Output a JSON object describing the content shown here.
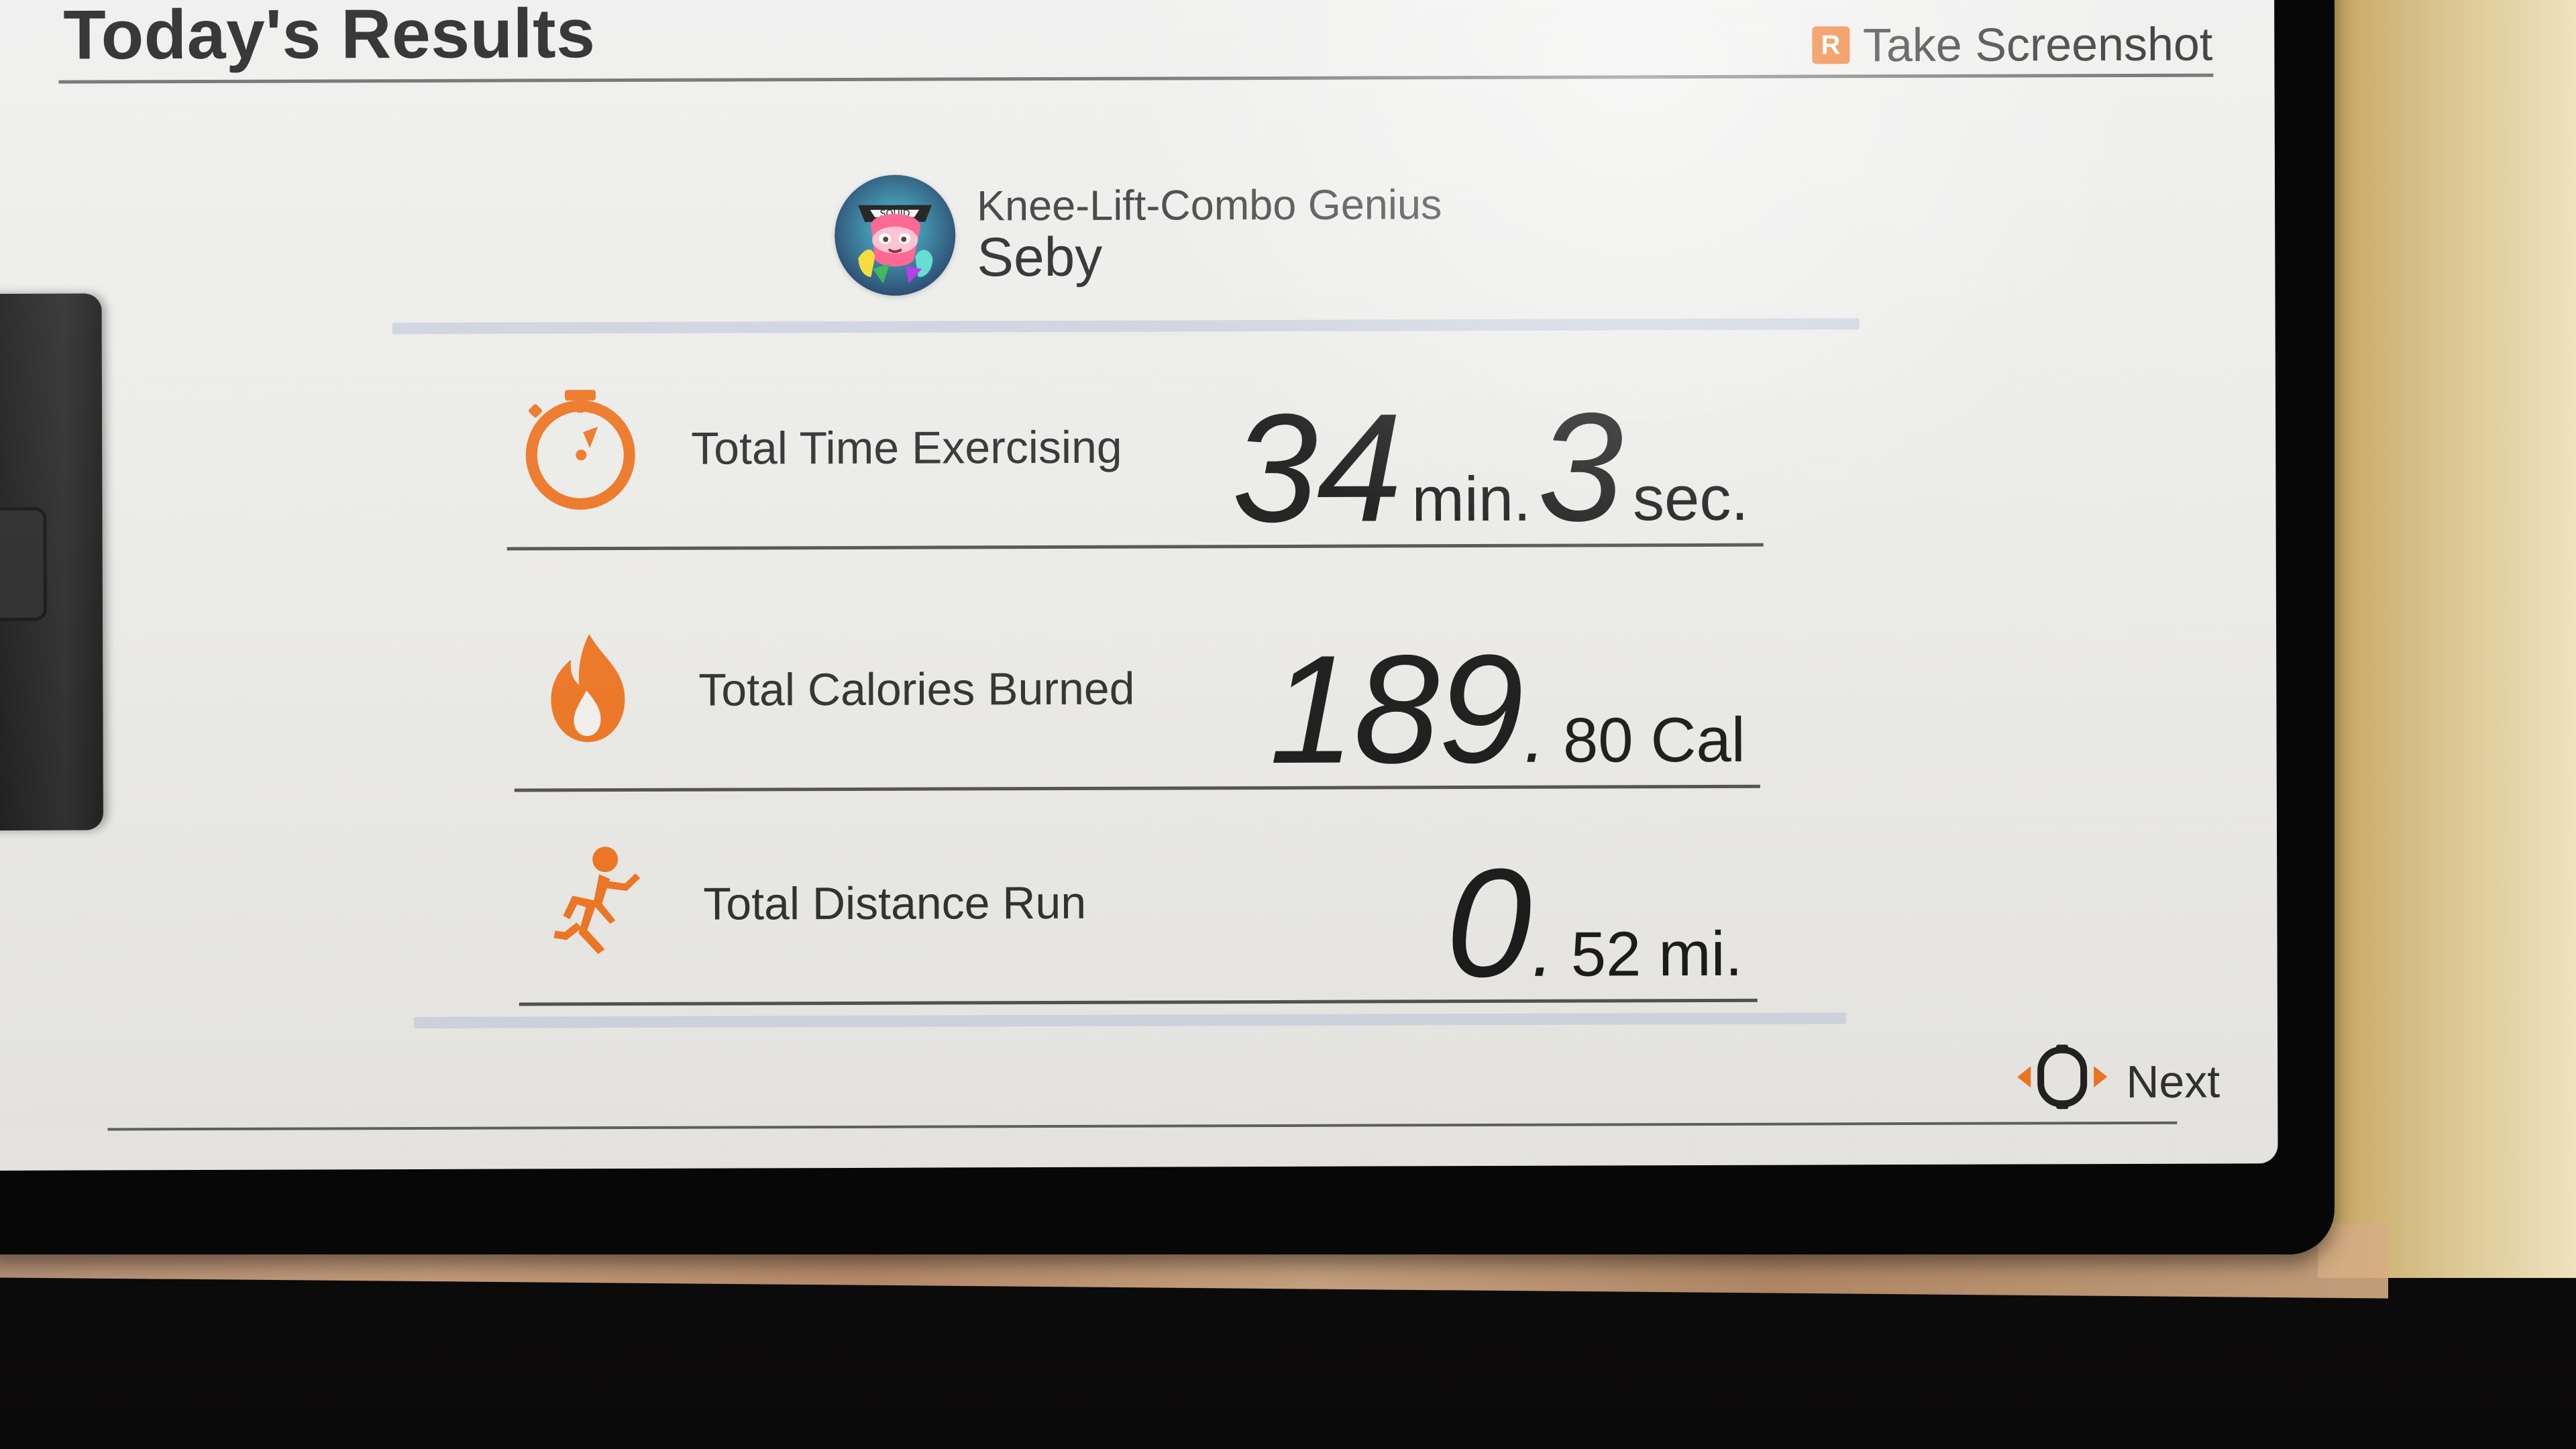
{
  "header": {
    "title": "Today's Results",
    "screenshot_key": "R",
    "screenshot_label": "Take Screenshot"
  },
  "profile": {
    "title": "Knee-Lift-Combo Genius",
    "name": "Seby",
    "avatar_icon": "character-avatar"
  },
  "stats": {
    "time": {
      "icon": "stopwatch-icon",
      "label": "Total Time Exercising",
      "minutes": "34",
      "minutes_unit": "min.",
      "seconds": "3",
      "seconds_unit": "sec."
    },
    "calories": {
      "icon": "flame-icon",
      "label": "Total Calories Burned",
      "whole": "189",
      "separator": ".",
      "fraction": "80",
      "unit": "Cal"
    },
    "distance": {
      "icon": "runner-icon",
      "label": "Total Distance Run",
      "whole": "0",
      "separator": ".",
      "fraction": "52",
      "unit": "mi."
    }
  },
  "footer": {
    "next_label": "Next",
    "next_icon": "ring-con-icon"
  },
  "colors": {
    "accent": "#EE7420",
    "text": "#1F1F1F",
    "screen_bg": "#ECECE9",
    "band": "#CFD4DF"
  }
}
